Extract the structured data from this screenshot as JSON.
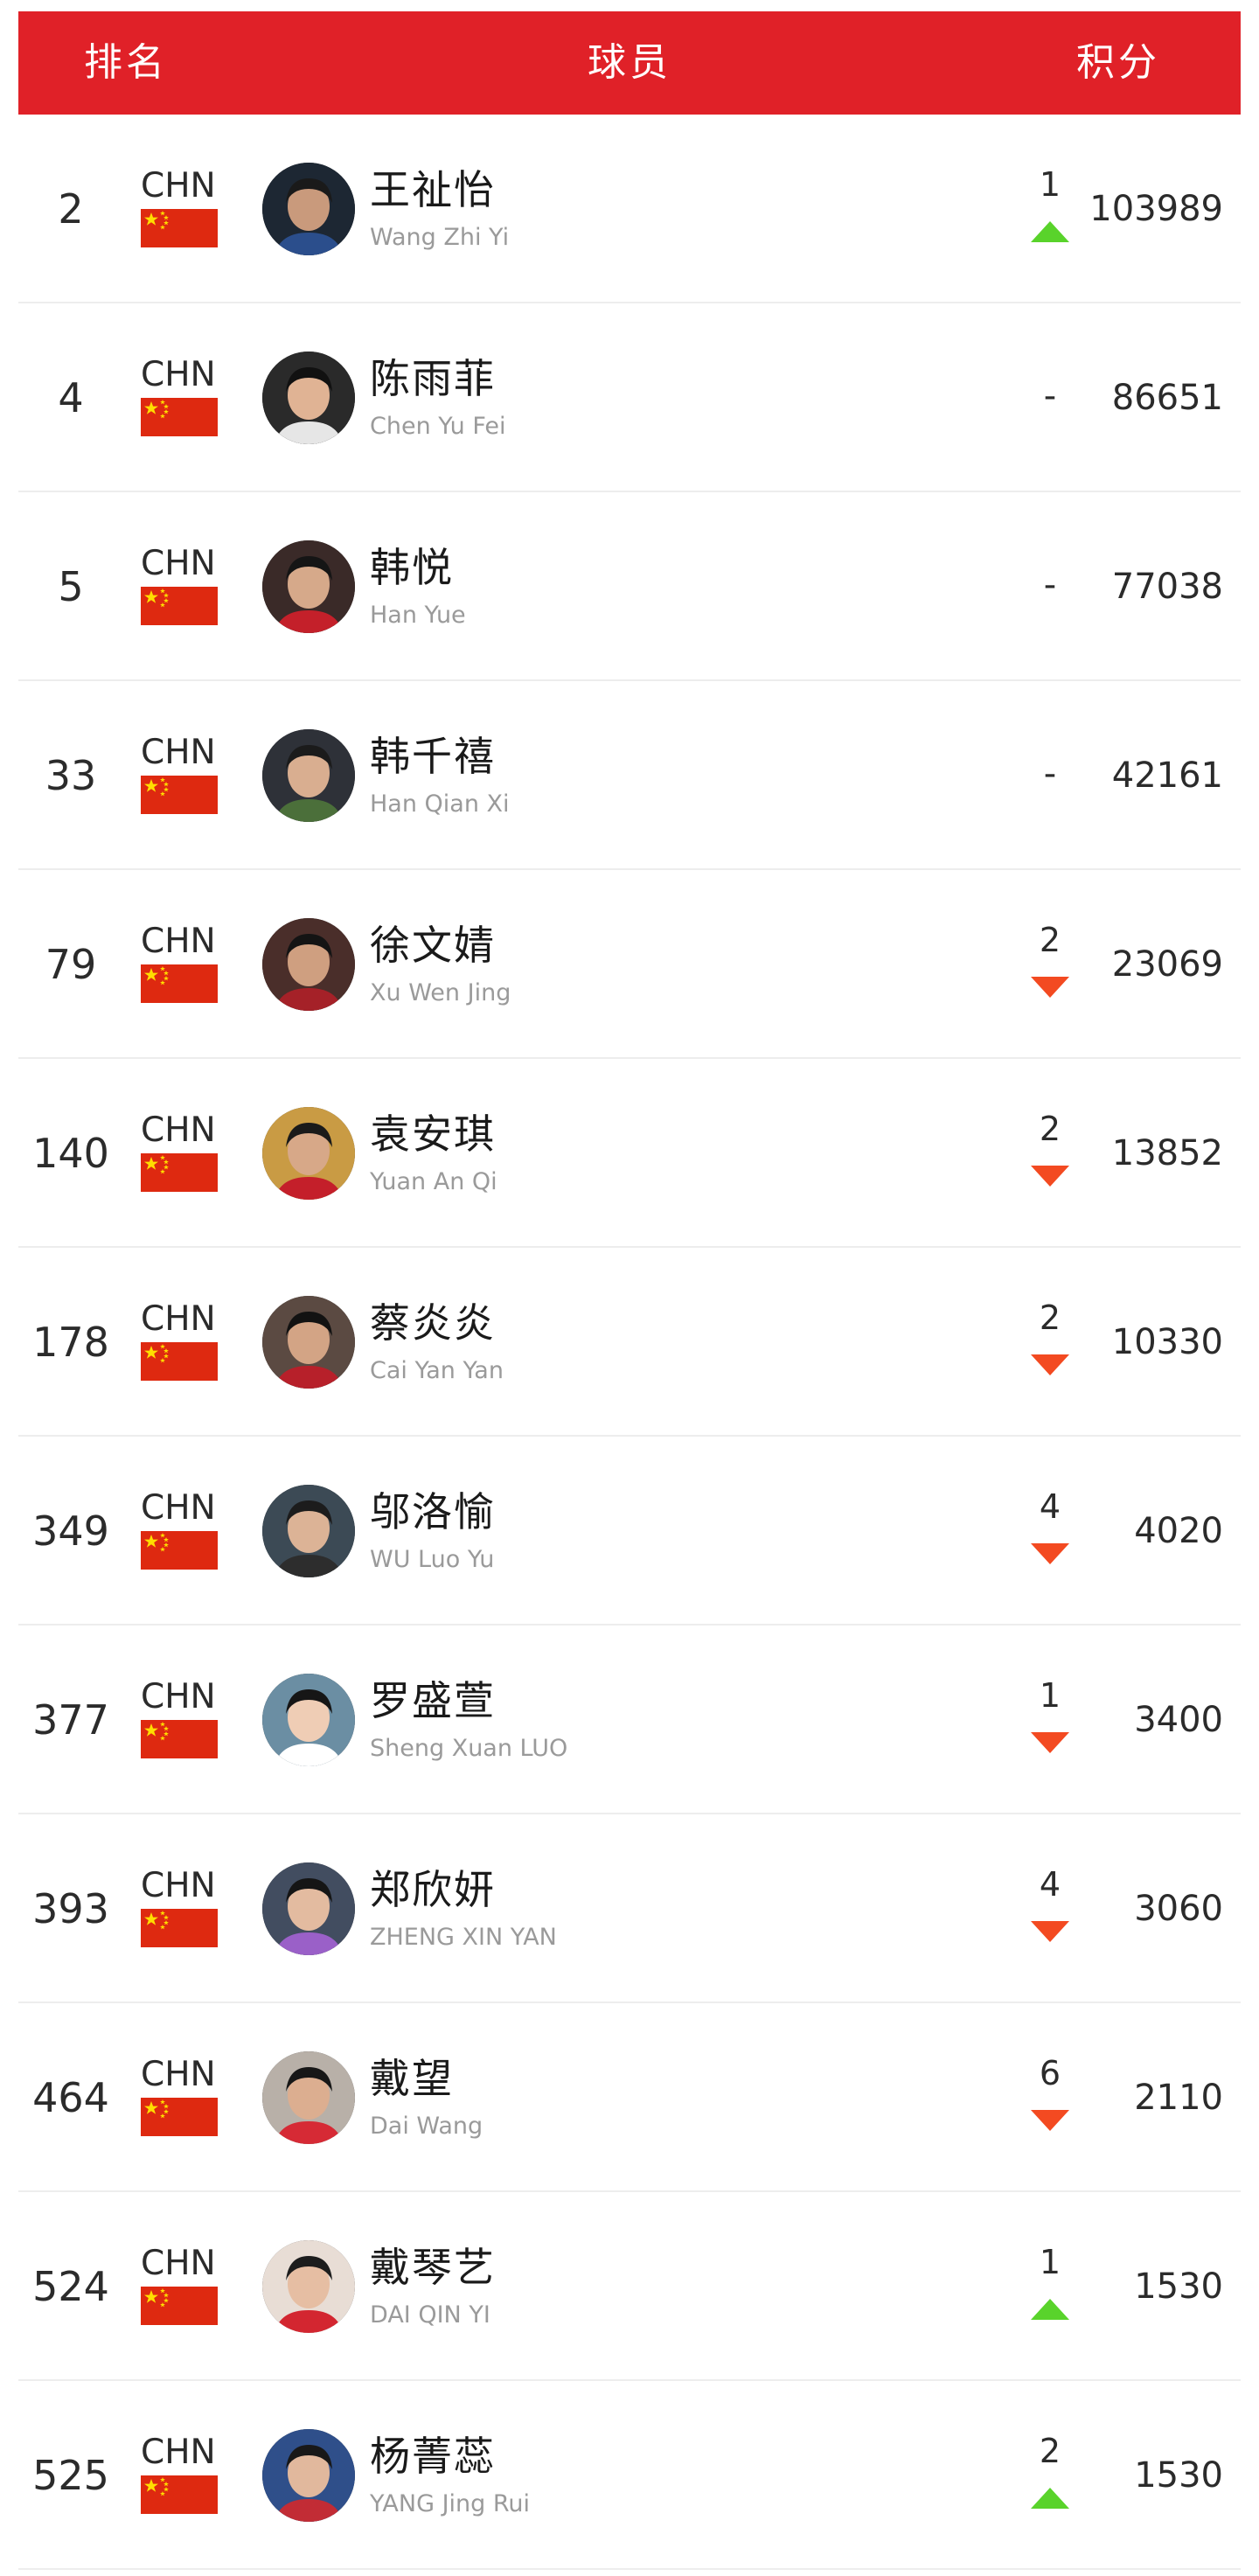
{
  "colors": {
    "header_bg": "#e02128",
    "rank_up": "#59d32b",
    "rank_down": "#f34a21",
    "flag_red": "#de2910",
    "flag_star": "#ffde00"
  },
  "header": {
    "rank": "排名",
    "player": "球员",
    "points": "积分"
  },
  "rows": [
    {
      "rank": "2",
      "country": "CHN",
      "name_cn": "王祉怡",
      "name_en": "Wang Zhi Yi",
      "change": "1",
      "trend": "up",
      "points": "103989"
    },
    {
      "rank": "4",
      "country": "CHN",
      "name_cn": "陈雨菲",
      "name_en": "Chen Yu Fei",
      "change": "-",
      "trend": "none",
      "points": "86651"
    },
    {
      "rank": "5",
      "country": "CHN",
      "name_cn": "韩悦",
      "name_en": "Han Yue",
      "change": "-",
      "trend": "none",
      "points": "77038"
    },
    {
      "rank": "33",
      "country": "CHN",
      "name_cn": "韩千禧",
      "name_en": "Han Qian Xi",
      "change": "-",
      "trend": "none",
      "points": "42161"
    },
    {
      "rank": "79",
      "country": "CHN",
      "name_cn": "徐文婧",
      "name_en": "Xu Wen Jing",
      "change": "2",
      "trend": "down",
      "points": "23069"
    },
    {
      "rank": "140",
      "country": "CHN",
      "name_cn": "袁安琪",
      "name_en": "Yuan An Qi",
      "change": "2",
      "trend": "down",
      "points": "13852"
    },
    {
      "rank": "178",
      "country": "CHN",
      "name_cn": "蔡炎炎",
      "name_en": "Cai Yan Yan",
      "change": "2",
      "trend": "down",
      "points": "10330"
    },
    {
      "rank": "349",
      "country": "CHN",
      "name_cn": "邬洛愉",
      "name_en": "WU Luo Yu",
      "change": "4",
      "trend": "down",
      "points": "4020"
    },
    {
      "rank": "377",
      "country": "CHN",
      "name_cn": "罗盛萱",
      "name_en": "Sheng Xuan LUO",
      "change": "1",
      "trend": "down",
      "points": "3400"
    },
    {
      "rank": "393",
      "country": "CHN",
      "name_cn": "郑欣妍",
      "name_en": "ZHENG XIN YAN",
      "change": "4",
      "trend": "down",
      "points": "3060"
    },
    {
      "rank": "464",
      "country": "CHN",
      "name_cn": "戴望",
      "name_en": "Dai Wang",
      "change": "6",
      "trend": "down",
      "points": "2110"
    },
    {
      "rank": "524",
      "country": "CHN",
      "name_cn": "戴琴艺",
      "name_en": "DAI QIN YI",
      "change": "1",
      "trend": "up",
      "points": "1530"
    },
    {
      "rank": "525",
      "country": "CHN",
      "name_cn": "杨菁蕊",
      "name_en": "YANG Jing Rui",
      "change": "2",
      "trend": "up",
      "points": "1530"
    }
  ]
}
